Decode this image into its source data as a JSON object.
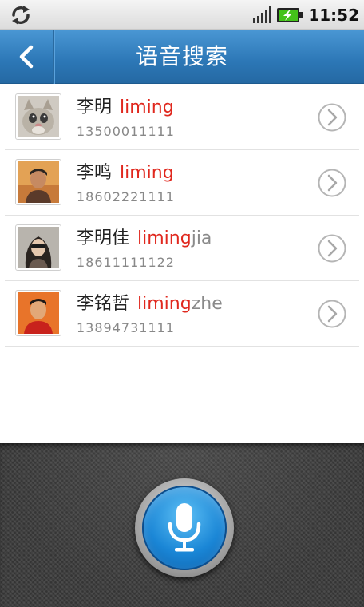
{
  "status_bar": {
    "time": "11:52",
    "icons": [
      "sync-icon",
      "signal-icon",
      "battery-charging-icon"
    ],
    "battery_color": "#44c21a"
  },
  "header": {
    "title": "语音搜索",
    "back_icon": "chevron-left-icon",
    "bg_color": "#2c77b6"
  },
  "contacts": [
    {
      "name": "李明",
      "pinyin_match": "liming",
      "pinyin_rest": "",
      "phone": "13500011111",
      "avatar": "cat-photo"
    },
    {
      "name": "李鸣",
      "pinyin_match": "liming",
      "pinyin_rest": "",
      "phone": "18602221111",
      "avatar": "person-photo"
    },
    {
      "name": "李明佳",
      "pinyin_match": "liming",
      "pinyin_rest": "jia",
      "phone": "18611111122",
      "avatar": "person-photo"
    },
    {
      "name": "李铭哲",
      "pinyin_match": "liming",
      "pinyin_rest": "zhe",
      "phone": "13894731111",
      "avatar": "person-photo"
    }
  ],
  "colors": {
    "match_highlight": "#e0281e",
    "secondary_text": "#888888"
  },
  "voice_panel": {
    "mic_icon": "microphone-icon",
    "mic_color": "#1a86d6"
  }
}
